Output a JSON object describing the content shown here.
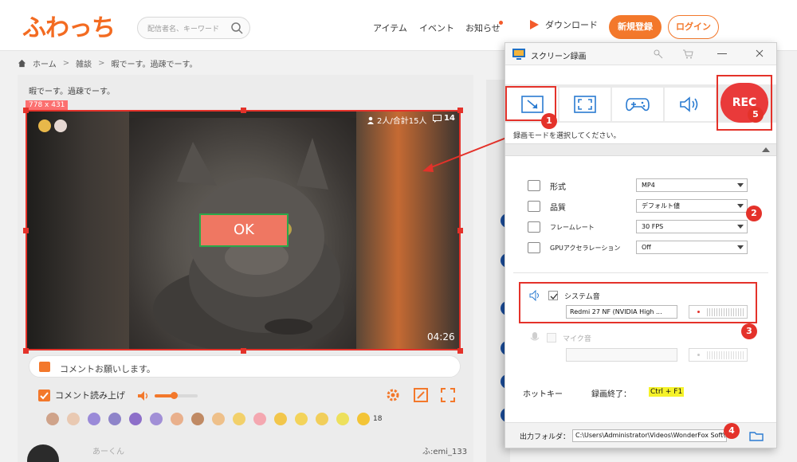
{
  "site": {
    "logo_text": "ふわっち",
    "search_placeholder": "配信者名、キーワード",
    "nav": [
      "アイテム",
      "イベント",
      "お知らせ"
    ],
    "download_label": "ダウンロード",
    "register_label": "新規登録",
    "login_label": "ログイン"
  },
  "breadcrumb": [
    "ホーム",
    "雑談",
    "暇でーす。過疎でーす。"
  ],
  "stream": {
    "title": "暇でーす。過疎でーす。",
    "selection_size": "778 x 431",
    "viewers": "2人/合計15人",
    "comment_count": "14",
    "timecode": "04:26",
    "ok_label": "OK",
    "comment_placeholder": "コメントお願いします。",
    "read_aloud_label": "コメント読み上げ",
    "volume_level": 0.45,
    "stamp_count": "18",
    "user_name": "あーくん",
    "user_id": "ふ:emi_133"
  },
  "recorder": {
    "title": "スクリーン録画",
    "rec_label": "REC",
    "mode_hint": "録画モードを選択してください。",
    "settings": [
      {
        "label": "形式",
        "value": "MP4"
      },
      {
        "label": "品質",
        "value": "デフォルト値"
      },
      {
        "label": "フレームレート",
        "value": "30 FPS"
      },
      {
        "label": "GPUアクセラレーション",
        "value": "Off"
      }
    ],
    "system_audio_label": "システム音",
    "system_audio_device": "Redmi 27 NF (NVIDIA High ...",
    "mic_label": "マイク音",
    "hotkey_label": "ホットキー",
    "hotkey_action": "録画終了：",
    "hotkey_key": "Ctrl + F1",
    "output_label": "出力フォルダ：",
    "output_path": "C:\\Users\\Administrator\\Videos\\WonderFox Soft\\HD Vid..."
  },
  "annotations": [
    "1",
    "2",
    "3",
    "4",
    "5"
  ],
  "colors": {
    "brand_orange": "#f3782b",
    "annotation_red": "#e4322a",
    "rec_red": "#e93a3a"
  }
}
